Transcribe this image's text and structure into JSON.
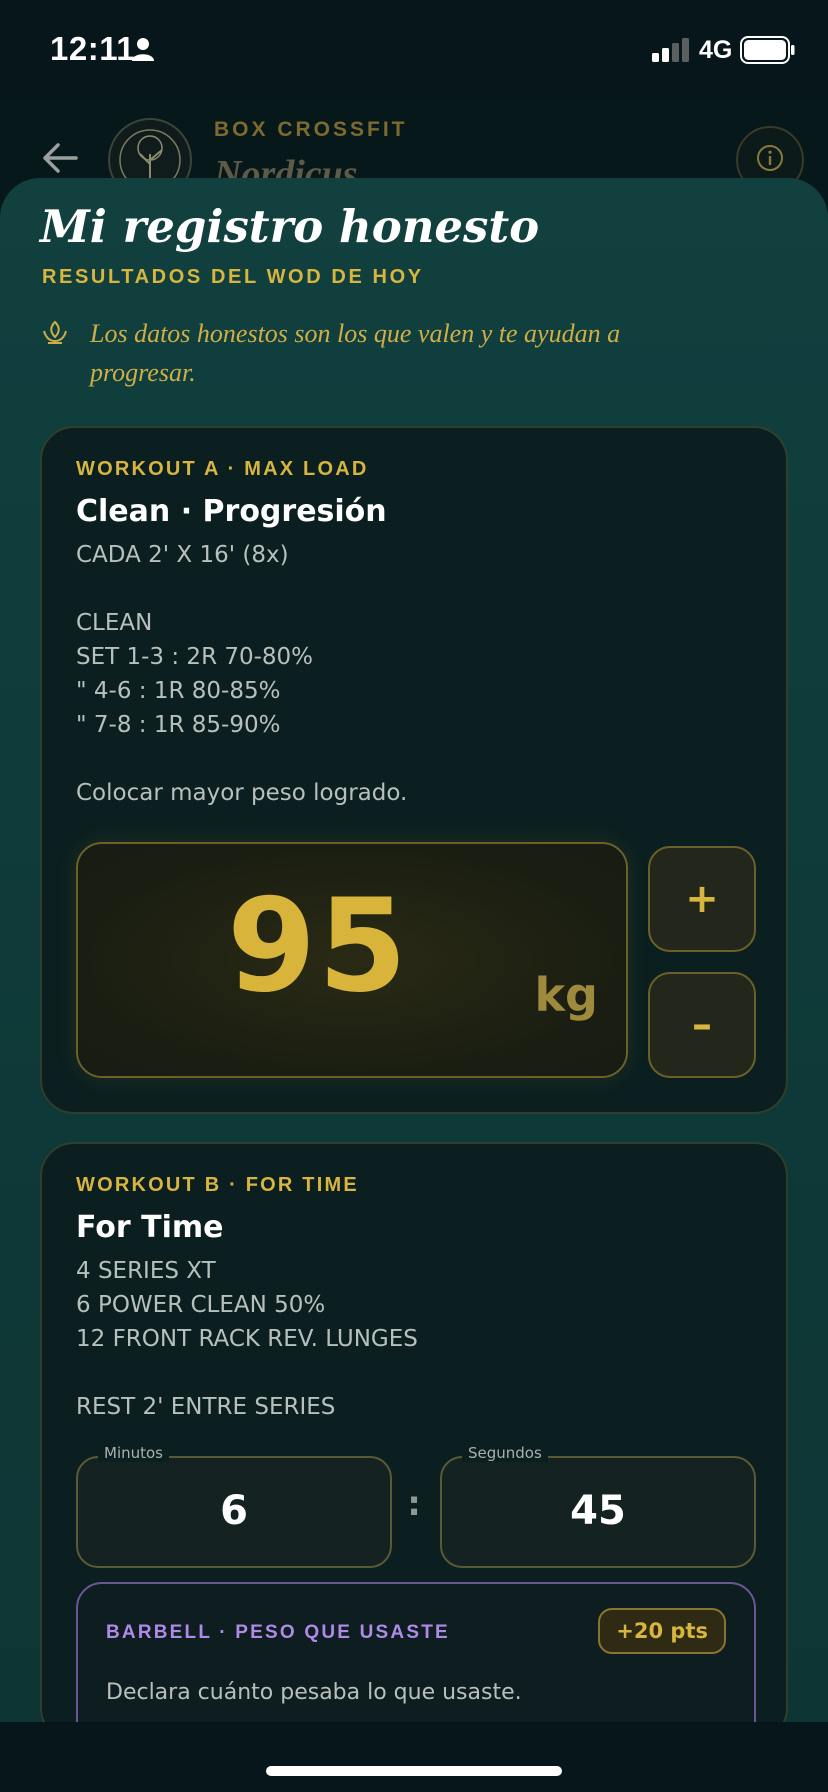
{
  "status_bar": {
    "time": "12:11",
    "network": "4G"
  },
  "header": {
    "box_label": "BOX CROSSFIT",
    "box_name": "Nordicus"
  },
  "sheet": {
    "title": "Mi registro honesto",
    "subtitle": "RESULTADOS DEL WOD DE HOY",
    "tip": "Los datos honestos son los que valen y te ayudan a progresar."
  },
  "workout_a": {
    "kicker": "WORKOUT A · MAX LOAD",
    "title": "Clean · Progresión",
    "description": [
      "CADA 2' X 16' (8x)",
      "",
      "CLEAN",
      "SET 1-3 : 2R 70-80%",
      "\" 4-6 : 1R 80-85%",
      "\" 7-8 : 1R 85-90%",
      "",
      "Colocar mayor peso logrado."
    ],
    "weight_value": "95",
    "weight_unit": "kg",
    "increment_label": "+",
    "decrement_label": "–"
  },
  "workout_b": {
    "kicker": "WORKOUT B · FOR TIME",
    "title": "For Time",
    "description": [
      "4 SERIES XT",
      "6 POWER CLEAN 50%",
      "12 FRONT RACK REV. LUNGES",
      "",
      "REST 2' ENTRE SERIES"
    ],
    "minutes_label": "Minutos",
    "minutes_value": "6",
    "separator": ":",
    "seconds_label": "Segundos",
    "seconds_value": "45",
    "barbell": {
      "kicker": "BARBELL · PESO QUE USASTE",
      "points": "+20 pts",
      "description": "Declara cuánto pesaba lo que usaste."
    }
  },
  "colors": {
    "accent_gold": "#d8b53e",
    "accent_purple": "#b08ae8",
    "sheet_bg": "#0f3b3a",
    "card_bg": "#0b1f20"
  },
  "icons": [
    "person-icon",
    "signal-icon",
    "battery-icon",
    "back-arrow-icon",
    "logo-tree-icon",
    "info-icon",
    "leaf-icon"
  ]
}
